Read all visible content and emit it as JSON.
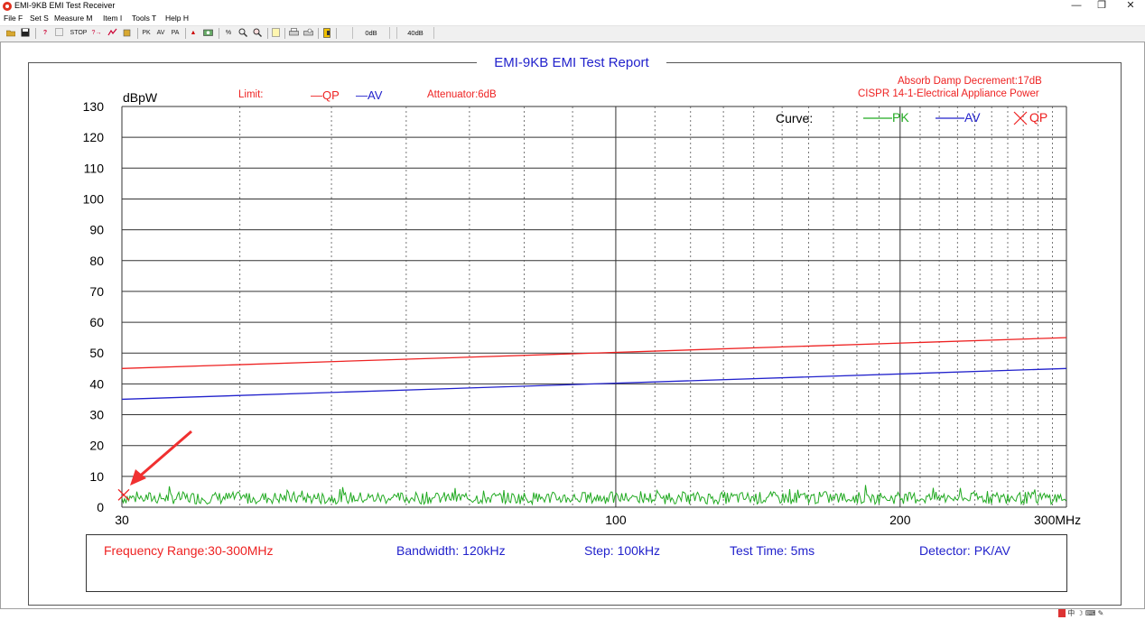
{
  "window": {
    "title": "EMI-9KB EMI Test Receiver",
    "minimize_glyph": "—",
    "restore_glyph": "❐",
    "close_glyph": "✕"
  },
  "menu": [
    "File F",
    "Set S",
    "Measure M",
    "Item I",
    "Tools T",
    "Help H"
  ],
  "toolbar": {
    "stop_label": "STOP",
    "pk_label": "PK",
    "av_label": "AV",
    "pa_label": "PA",
    "db0_label": "0dB",
    "db40_label": "40dB",
    "icons": [
      "open-icon",
      "save-icon",
      "help-icon",
      "info-icon",
      "stop-icon",
      "marker-icon",
      "scan-icon",
      "export-icon",
      "peak-icon",
      "average-icon",
      "pa-icon",
      "up-arrow-icon",
      "camera-icon",
      "percent-icon",
      "zoom-in-icon",
      "zoom-out-icon",
      "report-icon",
      "print-icon",
      "print-preview-icon",
      "exit-icon"
    ]
  },
  "report": {
    "title": "EMI-9KB EMI Test Report",
    "y_unit": "dBpW",
    "limit_label": "Limit:",
    "limit_qp": "—QP",
    "limit_av": "—AV",
    "attenuator": "Attenuator:6dB",
    "absorb": "Absorb Damp Decrement:17dB",
    "standard": "CISPR 14-1-Electrical Appliance Power",
    "curve_label": "Curve:",
    "curve_pk": "PK",
    "curve_av": "AV",
    "curve_qp": "QP"
  },
  "info": {
    "frequency_range": "Frequency Range:30-300MHz",
    "bandwidth": "Bandwidth: 120kHz",
    "step": "Step: 100kHz",
    "test_time": "Test Time: 5ms",
    "detector": "Detector: PK/AV"
  },
  "chart_data": {
    "type": "line",
    "xlabel": "MHz",
    "ylabel": "dBpW",
    "xlim": [
      30,
      300
    ],
    "ylim": [
      0,
      130
    ],
    "x_scale": "log",
    "grid": true,
    "y_ticks": [
      0,
      10,
      20,
      30,
      40,
      50,
      60,
      70,
      80,
      90,
      100,
      110,
      120,
      130
    ],
    "x_tick_labels": [
      "30",
      "100",
      "200",
      "300MHz"
    ],
    "x_tick_values": [
      30,
      100,
      200,
      300
    ],
    "series": [
      {
        "name": "QP",
        "color": "#ee2222",
        "x": [
          30,
          300
        ],
        "y": [
          45,
          55
        ]
      },
      {
        "name": "AV",
        "color": "#2222cc",
        "x": [
          30,
          300
        ],
        "y": [
          35,
          45
        ]
      },
      {
        "name": "PK",
        "color": "#22aa22",
        "x": [
          30,
          300
        ],
        "y_level": [
          3,
          3
        ],
        "noise_amplitude": 2
      }
    ],
    "qp_marker": {
      "x": 30,
      "y": 4
    }
  },
  "statusbar": {
    "text": "中 ☽ ⌨ ✎"
  }
}
